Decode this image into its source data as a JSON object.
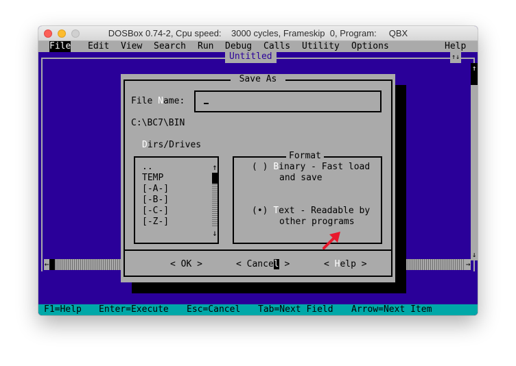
{
  "window": {
    "title": "DOSBox 0.74-2, Cpu speed:    3000 cycles, Frameskip  0, Program:     QBX"
  },
  "menu": [
    {
      "label": "File",
      "active": true
    },
    {
      "label": "Edit",
      "active": false
    },
    {
      "label": "View",
      "active": false
    },
    {
      "label": "Search",
      "active": false
    },
    {
      "label": "Run",
      "active": false
    },
    {
      "label": "Debug",
      "active": false
    },
    {
      "label": "Calls",
      "active": false
    },
    {
      "label": "Utility",
      "active": false
    },
    {
      "label": "Options",
      "active": false
    },
    {
      "label": "Help",
      "active": false
    }
  ],
  "editor": {
    "document_title": "Untitled",
    "top_right_box": "↑↓"
  },
  "dialog": {
    "title": "Save As",
    "file_name_label": {
      "hot_before": "File ",
      "hot": "N",
      "after": "ame:"
    },
    "file_name_value": "",
    "current_path": "C:\\BC7\\BIN",
    "dirs_label": {
      "hot": "D",
      "after": "irs/Drives"
    },
    "dirs": [
      "..",
      "TEMP",
      "[-A-]",
      "[-B-]",
      "[-C-]",
      "[-Z-]"
    ],
    "format_title": "Format",
    "format_options": [
      {
        "mark": "( )",
        "hot": "B",
        "line1": "inary - Fast load",
        "line2": "and save",
        "selected": false
      },
      {
        "mark": "(•)",
        "hot": "T",
        "line1": "ext - Readable by",
        "line2": "other programs",
        "selected": true
      }
    ],
    "buttons": {
      "ok": "< OK >",
      "cancel_pre": "< Cance",
      "cancel_hl": "l",
      "cancel_post": " >",
      "help_pre": "< ",
      "help_hot": "H",
      "help_post": "elp >"
    }
  },
  "status_bar": [
    "F1=Help",
    "Enter=Execute",
    "Esc=Cancel",
    "Tab=Next Field",
    "Arrow=Next Item"
  ],
  "colors": {
    "dos_blue": "#2a0099",
    "dos_gray": "#aaaaaa",
    "dos_cyan": "#00a8a8",
    "annotation_arrow": "#e8192c"
  },
  "icons": {
    "scroll_up": "↑",
    "scroll_down": "↓",
    "scroll_left": "←",
    "scroll_right": "→"
  }
}
